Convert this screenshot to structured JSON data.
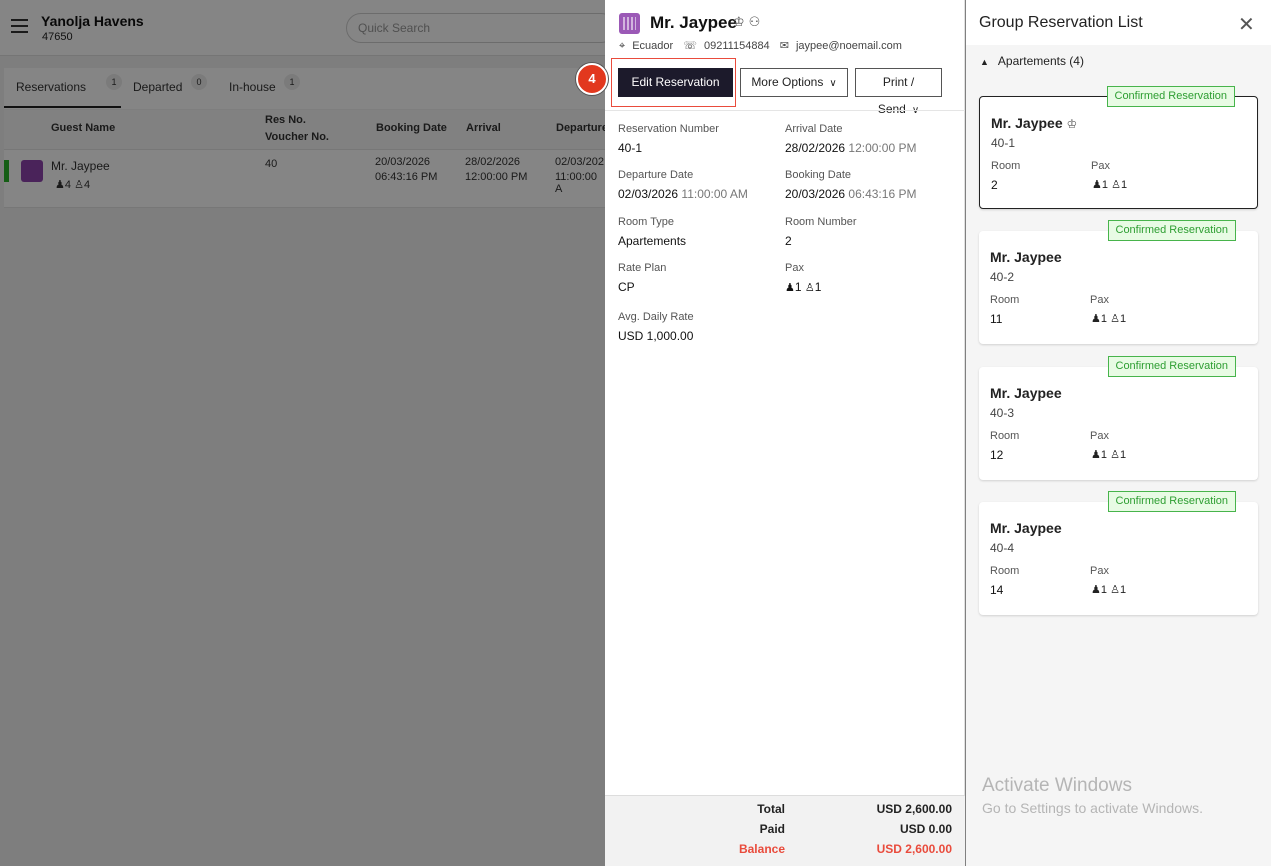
{
  "app": {
    "hotel_name": "Yanolja Havens",
    "hotel_id": "47650",
    "search_placeholder": "Quick Search"
  },
  "tabs": [
    {
      "label": "Reservations",
      "count": "1"
    },
    {
      "label": "Departed",
      "count": "0"
    },
    {
      "label": "In-house",
      "count": "1"
    }
  ],
  "table": {
    "headers": {
      "guest": "Guest Name",
      "resno": "Res No.",
      "voucher": "Voucher No.",
      "booking": "Booking Date",
      "arrival": "Arrival",
      "departure": "Departure"
    },
    "row": {
      "guest": "Mr. Jaypee",
      "adults": "4",
      "children": "4",
      "resno": "40",
      "booking_date": "20/03/2026",
      "booking_time": "06:43:16 PM",
      "arrival_date": "28/02/2026",
      "arrival_time": "12:00:00 PM",
      "departure_date": "02/03/202",
      "departure_time": "11:00:00 A"
    }
  },
  "detail": {
    "guest_name": "Mr. Jaypee",
    "country": "Ecuador",
    "phone": "09211154884",
    "email": "jaypee@noemail.com",
    "step_number": "4",
    "buttons": {
      "edit": "Edit Reservation",
      "more": "More Options",
      "print": "Print / Send"
    },
    "fields": {
      "res_number_label": "Reservation Number",
      "res_number": "40-1",
      "arrival_label": "Arrival Date",
      "arrival_date": "28/02/2026",
      "arrival_time": "12:00:00 PM",
      "departure_label": "Departure Date",
      "departure_date": "02/03/2026",
      "departure_time": "11:00:00 AM",
      "booking_label": "Booking Date",
      "booking_date": "20/03/2026",
      "booking_time": "06:43:16 PM",
      "room_type_label": "Room Type",
      "room_type": "Apartements",
      "room_number_label": "Room Number",
      "room_number": "2",
      "rate_plan_label": "Rate Plan",
      "rate_plan": "CP",
      "pax_label": "Pax",
      "pax_adults": "1",
      "pax_children": "1",
      "adr_label": "Avg. Daily Rate",
      "adr": "USD 1,000.00"
    },
    "totals": {
      "total_label": "Total",
      "total": "USD 2,600.00",
      "paid_label": "Paid",
      "paid": "USD 0.00",
      "balance_label": "Balance",
      "balance": "USD 2,600.00"
    }
  },
  "group": {
    "title": "Group Reservation List",
    "section": "Apartements (4)",
    "room_label": "Room",
    "pax_label": "Pax",
    "cards": [
      {
        "status": "Confirmed Reservation",
        "name": "Mr. Jaypee",
        "res_no": "40-1",
        "room": "2",
        "adults": "1",
        "children": "1"
      },
      {
        "status": "Confirmed Reservation",
        "name": "Mr. Jaypee",
        "res_no": "40-2",
        "room": "11",
        "adults": "1",
        "children": "1"
      },
      {
        "status": "Confirmed Reservation",
        "name": "Mr. Jaypee",
        "res_no": "40-3",
        "room": "12",
        "adults": "1",
        "children": "1"
      },
      {
        "status": "Confirmed Reservation",
        "name": "Mr. Jaypee",
        "res_no": "40-4",
        "room": "14",
        "adults": "1",
        "children": "1"
      }
    ]
  },
  "watermark": {
    "title": "Activate Windows",
    "subtitle": "Go to Settings to activate Windows."
  },
  "colors": {
    "accent_dark": "#1c1a2b",
    "highlight_red": "#e94b3c",
    "confirmed_green": "#47b44b",
    "hotel_purple": "#9b59b6"
  },
  "icons": [
    "hamburger-icon",
    "hotel-icon",
    "vip-crown-icon",
    "guest-profile-icon",
    "location-icon",
    "phone-icon",
    "email-icon",
    "chevron-down-icon",
    "close-icon",
    "collapse-triangle-icon",
    "adult-icon",
    "child-icon"
  ]
}
